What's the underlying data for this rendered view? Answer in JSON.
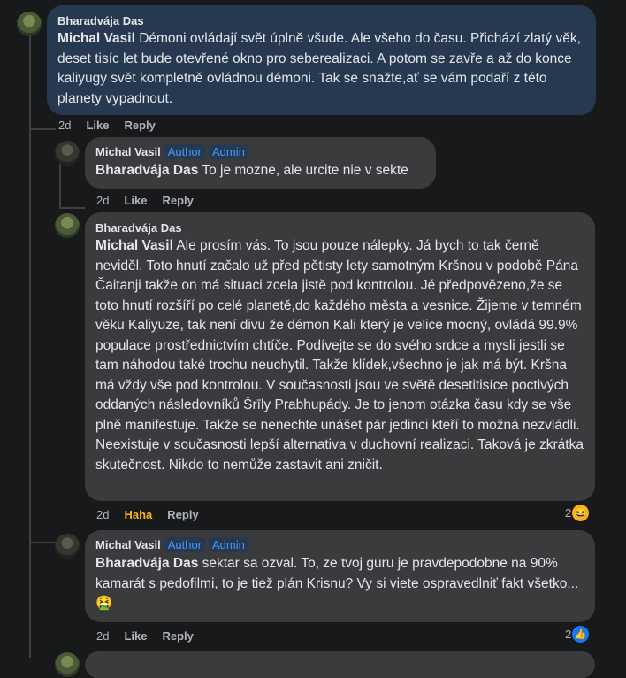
{
  "comments": [
    {
      "author": "Bharadvája Das",
      "mention": "Michal Vasil",
      "text": " Démoni ovládají svět úplně všude. Ale všeho do času. Přichází zlatý věk, deset tisíc let bude otevřené okno pro seberealizaci. A potom se zavře a až do konce kaliyugy svět kompletně ovládnou démoni. Tak se snažte,ať se vám podaří z této planety vypadnout.",
      "time": "2d",
      "like": "Like",
      "reply": "Reply"
    },
    {
      "author": "Michal Vasil",
      "badges": [
        "Author",
        "Admin"
      ],
      "mention": "Bharadvája Das",
      "text": " To je mozne, ale urcite nie v sekte",
      "time": "2d",
      "like": "Like",
      "reply": "Reply"
    },
    {
      "author": "Bharadvája Das",
      "mention": "Michal Vasil",
      "text": " Ale prosím vás. To jsou pouze nálepky. Já bych to tak černě neviděl. Toto hnutí začalo už před pětisty lety samotným Kršnou v podobě Pána Čaitanji takže on má situaci zcela jistě pod kontrolou. Jé předpovězeno,že se toto hnutí rozšíří po celé planetě,do každého města a vesnice. Žijeme v temném věku Kaliyuze, tak není divu že démon Kali který je velice mocný, ovládá 99.9% populace prostřednictvím chtíče. Podívejte se do svého srdce a mysli jestli se tam náhodou také trochu neuchytil. Takže klídek,všechno je jak má být. Kršna má vždy vše pod kontrolou. V současnosti jsou ve světě desetitisíce poctivých oddaných následovníků Šrīly Prabhupády. Je to jenom otázka času kdy se vše plně manifestuje. Takže se nenechte unášet pár jedinci kteří to možná nezvládli. Neexistuje v současnosti lepší alternativa v duchovní realizaci. Taková je zkrátka skutečnost. Nikdo to nemůže zastavit ani zničit.",
      "time": "2d",
      "reaction_label": "Haha",
      "reply": "Reply",
      "reaction_count": "2",
      "reaction_emoji": "😆"
    },
    {
      "author": "Michal Vasil",
      "badges": [
        "Author",
        "Admin"
      ],
      "mention": "Bharadvája Das",
      "text": " sektar sa ozval. To, ze tvoj guru je pravdepodobne na 90% kamarát s pedofilmi, to je tiež plán Krisnu? Vy si viete ospravedlniť fakt všetko... 🤮",
      "time": "2d",
      "like": "Like",
      "reply": "Reply",
      "reaction_count": "2",
      "reaction_emoji": "👍"
    }
  ],
  "colors": {
    "background": "#18191a",
    "bubble": "#3a3b3c",
    "highlighted_bubble": "#263951",
    "badge_text": "#4599ff",
    "haha": "#f7b125",
    "like_reaction": "#1877f2"
  }
}
